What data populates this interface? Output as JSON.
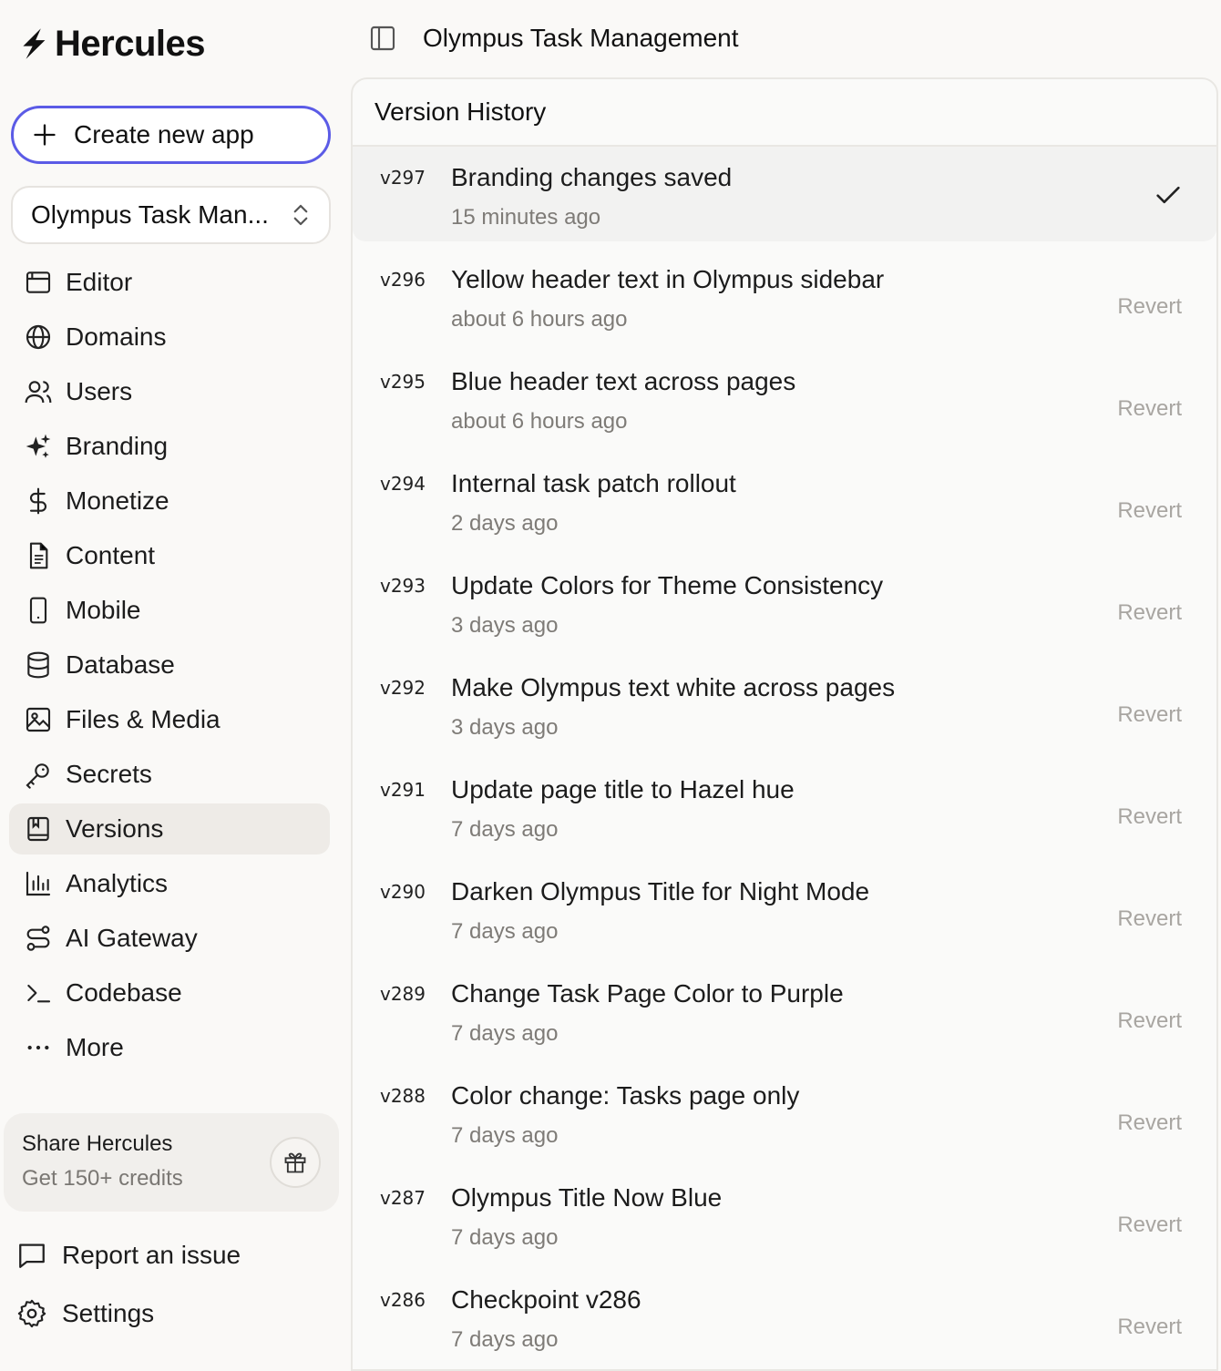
{
  "brand": {
    "name": "Hercules"
  },
  "sidebar": {
    "create_label": "Create new app",
    "app_selector": "Olympus Task Man...",
    "items": [
      {
        "label": "Editor",
        "icon": "editor-icon"
      },
      {
        "label": "Domains",
        "icon": "globe-icon"
      },
      {
        "label": "Users",
        "icon": "users-icon"
      },
      {
        "label": "Branding",
        "icon": "sparkles-icon"
      },
      {
        "label": "Monetize",
        "icon": "dollar-icon"
      },
      {
        "label": "Content",
        "icon": "document-icon"
      },
      {
        "label": "Mobile",
        "icon": "mobile-icon"
      },
      {
        "label": "Database",
        "icon": "database-icon"
      },
      {
        "label": "Files & Media",
        "icon": "image-icon"
      },
      {
        "label": "Secrets",
        "icon": "key-icon"
      },
      {
        "label": "Versions",
        "icon": "versions-icon",
        "active": true
      },
      {
        "label": "Analytics",
        "icon": "chart-icon"
      },
      {
        "label": "AI Gateway",
        "icon": "route-icon"
      },
      {
        "label": "Codebase",
        "icon": "terminal-icon"
      },
      {
        "label": "More",
        "icon": "more-icon"
      }
    ],
    "share": {
      "title": "Share Hercules",
      "subtitle": "Get 150+ credits"
    },
    "report_label": "Report an issue",
    "settings_label": "Settings"
  },
  "topbar": {
    "title": "Olympus Task Management"
  },
  "panel": {
    "title": "Version History",
    "revert_label": "Revert",
    "versions": [
      {
        "num": "v297",
        "title": "Branding changes saved",
        "time": "15 minutes ago",
        "current": true
      },
      {
        "num": "v296",
        "title": "Yellow header text in Olympus sidebar",
        "time": "about 6 hours ago"
      },
      {
        "num": "v295",
        "title": "Blue header text across pages",
        "time": "about 6 hours ago"
      },
      {
        "num": "v294",
        "title": "Internal task patch rollout",
        "time": "2 days ago"
      },
      {
        "num": "v293",
        "title": "Update Colors for Theme Consistency",
        "time": "3 days ago"
      },
      {
        "num": "v292",
        "title": "Make Olympus text white across pages",
        "time": "3 days ago"
      },
      {
        "num": "v291",
        "title": "Update page title to Hazel hue",
        "time": "7 days ago"
      },
      {
        "num": "v290",
        "title": "Darken Olympus Title for Night Mode",
        "time": "7 days ago"
      },
      {
        "num": "v289",
        "title": "Change Task Page Color to Purple",
        "time": "7 days ago"
      },
      {
        "num": "v288",
        "title": "Color change: Tasks page only",
        "time": "7 days ago"
      },
      {
        "num": "v287",
        "title": "Olympus Title Now Blue",
        "time": "7 days ago"
      },
      {
        "num": "v286",
        "title": "Checkpoint v286",
        "time": "7 days ago"
      }
    ]
  },
  "colors": {
    "accent": "#5b5be6",
    "active_bg": "#eeebe7",
    "muted_text": "#7e7b77"
  }
}
